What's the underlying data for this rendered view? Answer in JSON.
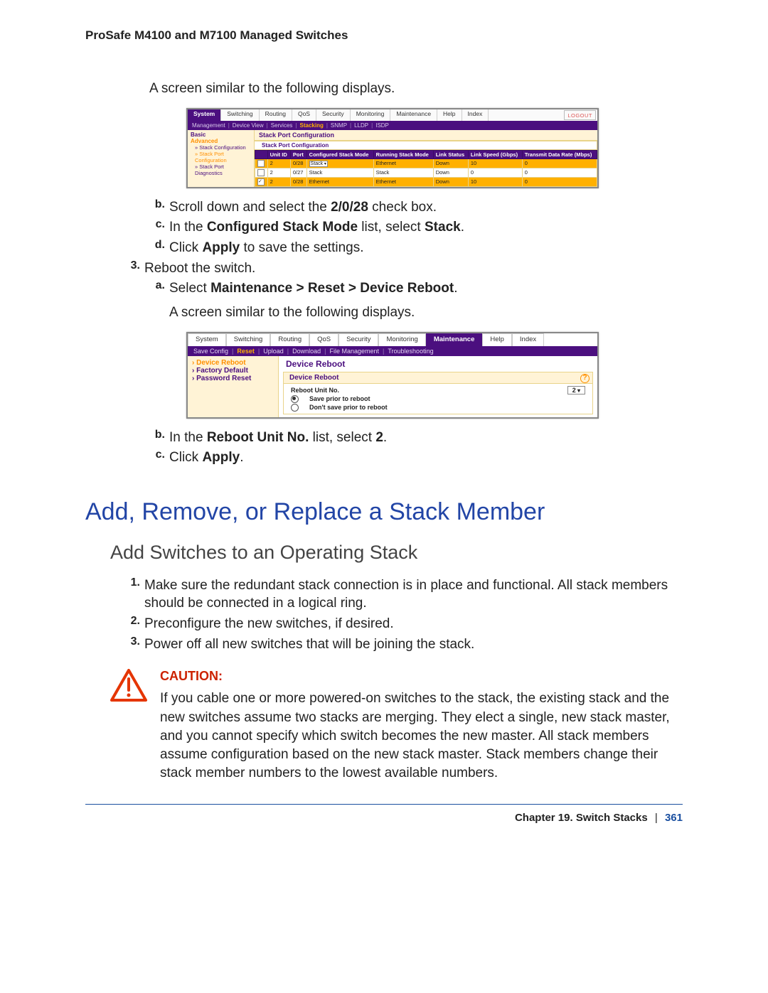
{
  "header": {
    "title": "ProSafe M4100 and M7100 Managed Switches"
  },
  "body": {
    "intro1": "A screen similar to the following displays.",
    "intro2": "A screen similar to the following displays."
  },
  "shot1": {
    "tabs": [
      "System",
      "Switching",
      "Routing",
      "QoS",
      "Security",
      "Monitoring",
      "Maintenance",
      "Help",
      "Index"
    ],
    "active_tab": "System",
    "logout": "LOGOUT",
    "subnav": [
      "Management",
      "Device View",
      "Services",
      "Stacking",
      "SNMP",
      "LLDP",
      "ISDP"
    ],
    "subnav_hl": "Stacking",
    "side": {
      "basic": "Basic",
      "advanced": "Advanced",
      "items": [
        {
          "label": "Stack Configuration",
          "hl": false
        },
        {
          "label": "Stack Port Configuration",
          "hl": true
        },
        {
          "label": "Stack Port Diagnostics",
          "hl": false
        }
      ]
    },
    "panel_title": "Stack Port Configuration",
    "sub_title": "Stack Port Configuration",
    "columns": [
      "",
      "Unit ID",
      "Port",
      "Configured Stack Mode",
      "Running Stack Mode",
      "Link Status",
      "Link Speed (Gbps)",
      "Transmit Data Rate (Mbps)"
    ],
    "rows": [
      {
        "o": true,
        "cb": false,
        "unit": "2",
        "port": "0/28",
        "csm_sel": "Stack",
        "rsm": "Ethernet",
        "ls": "Down",
        "spd": "10",
        "tx": "0"
      },
      {
        "o": false,
        "cb": false,
        "unit": "2",
        "port": "0/27",
        "csm": "Stack",
        "rsm": "Stack",
        "ls": "Down",
        "spd": "0",
        "tx": "0"
      },
      {
        "o": true,
        "cb": true,
        "unit": "2",
        "port": "0/28",
        "csm": "Ethernet",
        "rsm": "Ethernet",
        "ls": "Down",
        "spd": "10",
        "tx": "0"
      }
    ]
  },
  "steps": {
    "b1": {
      "marker": "b.",
      "pre": "Scroll down and select the ",
      "bold": "2/0/28",
      "post": " check box."
    },
    "c1": {
      "marker": "c.",
      "pre": "In the ",
      "bold1": "Configured Stack Mode",
      "mid": " list, select ",
      "bold2": "Stack",
      "post": "."
    },
    "d1": {
      "marker": "d.",
      "pre": "Click ",
      "bold": "Apply",
      "post": " to save the settings."
    },
    "s3": {
      "marker": "3.",
      "text": "Reboot the switch."
    },
    "a2": {
      "marker": "a.",
      "pre": "Select ",
      "bold": "Maintenance > Reset > Device Reboot",
      "post": "."
    },
    "b2": {
      "marker": "b.",
      "pre": "In the ",
      "bold1": "Reboot Unit No.",
      "mid": " list, select ",
      "bold2": "2",
      "post": "."
    },
    "c2": {
      "marker": "c.",
      "pre": "Click ",
      "bold": "Apply",
      "post": "."
    }
  },
  "shot2": {
    "tabs": [
      "System",
      "Switching",
      "Routing",
      "QoS",
      "Security",
      "Monitoring",
      "Maintenance",
      "Help",
      "Index"
    ],
    "active_tab": "Maintenance",
    "subnav": [
      "Save Config",
      "Reset",
      "Upload",
      "Download",
      "File Management",
      "Troubleshooting"
    ],
    "subnav_hl": "Reset",
    "side": [
      "Device Reboot",
      "Factory Default",
      "Password Reset"
    ],
    "side_sel": "Device Reboot",
    "panel_title": "Device Reboot",
    "box_title": "Device Reboot",
    "reboot_label": "Reboot Unit No.",
    "reboot_value": "2",
    "r1": "Save prior to reboot",
    "r2": "Don't save prior to reboot"
  },
  "h1": "Add, Remove, or Replace a Stack Member",
  "h2": "Add Switches to an Operating Stack",
  "addsteps": {
    "s1": {
      "marker": "1.",
      "text": "Make sure the redundant stack connection is in place and functional. All stack members should be connected in a logical ring."
    },
    "s2": {
      "marker": "2.",
      "text": "Preconfigure the new switches, if desired."
    },
    "s3": {
      "marker": "3.",
      "text": "Power off all new switches that will be joining the stack."
    }
  },
  "caution": {
    "label": "CAUTION:",
    "text": "If you cable one or more powered-on switches to the stack, the existing stack and the new switches assume two stacks are merging. They elect a single, new stack master, and you cannot specify which switch becomes the new master. All stack members assume configuration based on the new stack master. Stack members change their stack member numbers to the lowest available numbers."
  },
  "footer": {
    "chapter": "Chapter 19.  Switch Stacks",
    "sep": "|",
    "page": "361"
  }
}
